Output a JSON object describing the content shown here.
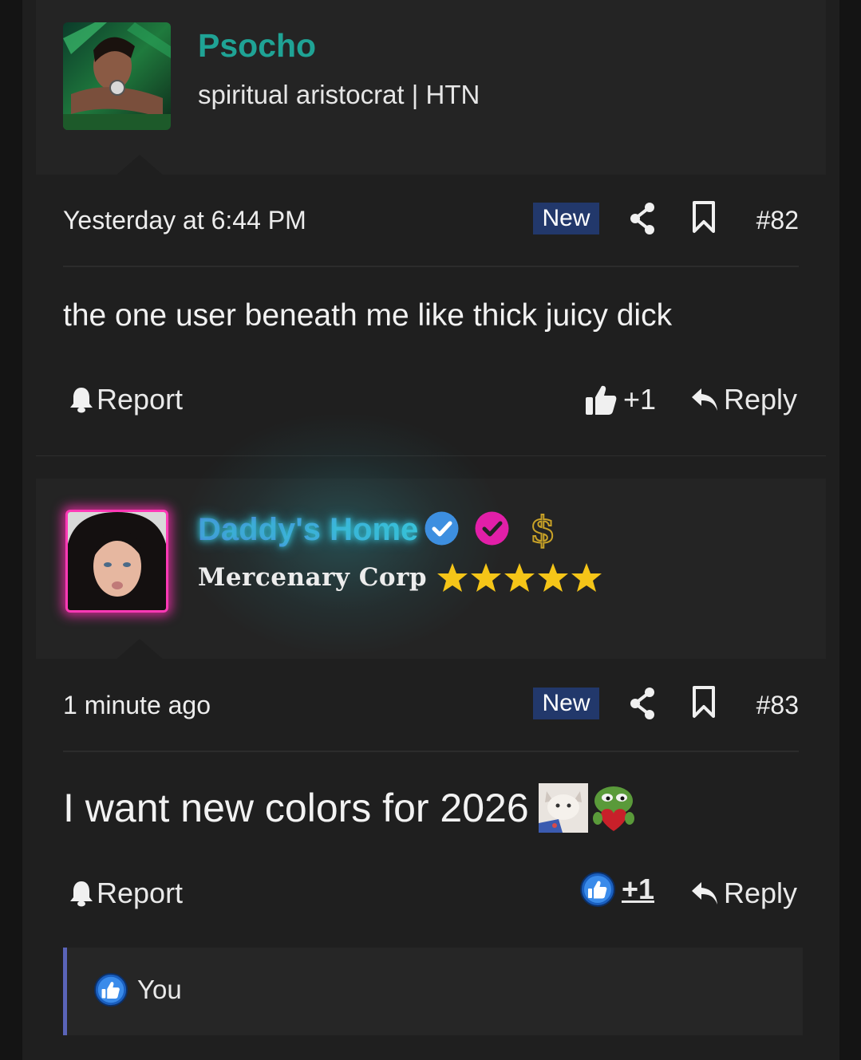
{
  "posts": [
    {
      "username": "Psocho",
      "username_color": "#1fa395",
      "user_title": "spiritual aristocrat | HTN",
      "date": "Yesterday at 6:44 PM",
      "badge": "New",
      "post_number": "#82",
      "body": "the one user beneath me like thick juicy dick",
      "report_label": "Report",
      "like_count": "+1",
      "reply_label": "Reply"
    },
    {
      "username": "Daddy's Home",
      "username_color": "#3bb6d6",
      "user_title": "Mercenary Corp",
      "star_rating": 5,
      "star_color": "#f5c518",
      "date": "1 minute ago",
      "badge": "New",
      "post_number": "#83",
      "body": "I want new colors for 2026",
      "report_label": "Report",
      "like_count": "+1",
      "reply_label": "Reply",
      "reactions": [
        {
          "icon": "like-icon",
          "label": "You"
        }
      ]
    }
  ],
  "colors": {
    "accent_new": "#22386b",
    "verified_blue": "#3d8fe0",
    "verified_pink": "#e21fa8",
    "avatar_glow": "#ff2fb4",
    "dollar_gold": "#c9a227",
    "reaction_bar": "#5a64b8"
  }
}
